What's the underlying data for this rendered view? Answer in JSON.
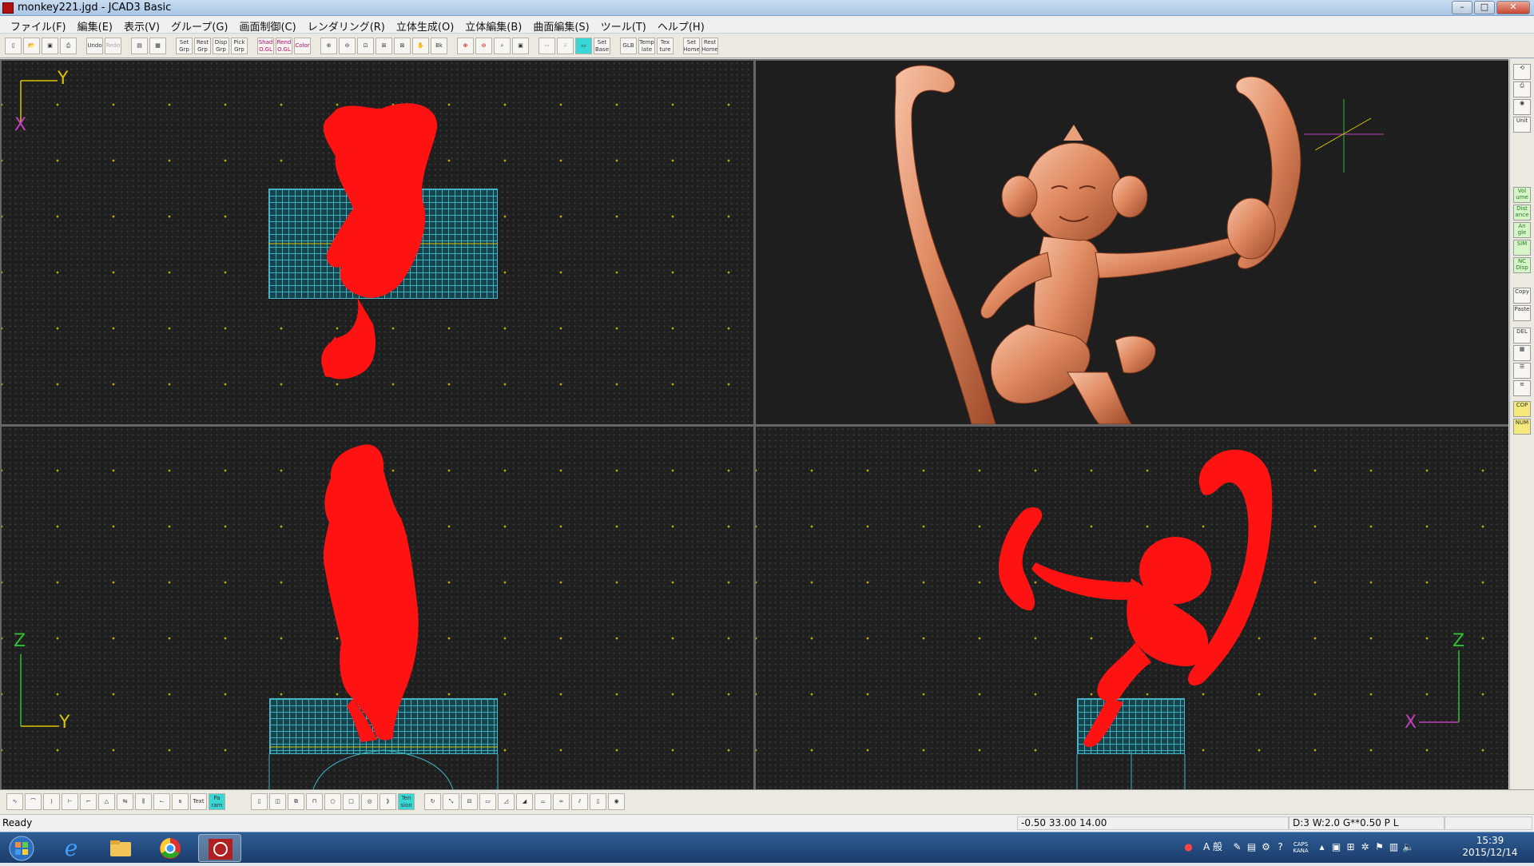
{
  "window": {
    "title": "monkey221.jgd - JCAD3 Basic",
    "controls": [
      "–",
      "□",
      "✕"
    ]
  },
  "menu": {
    "items": [
      "ファイル(F)",
      "編集(E)",
      "表示(V)",
      "グループ(G)",
      "画面制御(C)",
      "レンダリング(R)",
      "立体生成(O)",
      "立体編集(B)",
      "曲面編集(S)",
      "ツール(T)",
      "ヘルプ(H)"
    ]
  },
  "toolbar": {
    "labels": {
      "undo": "Undo",
      "redo": "Redo",
      "set_grp": "Set Grp",
      "rest_grp": "Rest Grp",
      "disp_grp": "Disp Grp",
      "pick_grp": "Pick Grp",
      "shad": "Shad O.GL",
      "rend": "Rend O.GL",
      "color": "Color",
      "glb": "GLB",
      "temp": "Temp late",
      "texture": "Tex ture",
      "set_home": "Set Home",
      "rest_home": "Rest Home",
      "set_base": "Set Base",
      "bk": "Bk"
    }
  },
  "viewports": {
    "top": {
      "axis_v": "Y",
      "axis_h": "X"
    },
    "front": {
      "axis_v": "Z",
      "axis_h": "Y"
    },
    "side": {
      "axis_v": "Z",
      "axis_h": "X"
    }
  },
  "right_panel": {
    "labels": {
      "unit": "Unit",
      "volume": "Vol ume",
      "distance": "Dist ance",
      "angle": "An gle",
      "sim": "SIM",
      "nc": "NC Disp",
      "copy": "Copy",
      "paste": "Paste",
      "del": "DEL",
      "cop": "COP",
      "num": "NUM"
    }
  },
  "bottom_toolbar": {
    "labels": {
      "text": "Text",
      "param": "Pa ram",
      "ten": "Ten sion"
    }
  },
  "status": {
    "ready": "Ready",
    "coords": "-0.50 33.00 14.00",
    "info": "D:3 W:2.0  G**0.50 P   L"
  },
  "taskbar": {
    "time": "15:39",
    "date": "2015/12/14",
    "ime": "A 般",
    "caps": "CAPS KANA"
  },
  "colors": {
    "model_red": "#ff1212",
    "copper": "#e08a62",
    "grid_cyan": "#3fb0c0",
    "axis_yellow": "#d8c400",
    "axis_magenta": "#c040c0",
    "axis_green": "#30c030"
  }
}
